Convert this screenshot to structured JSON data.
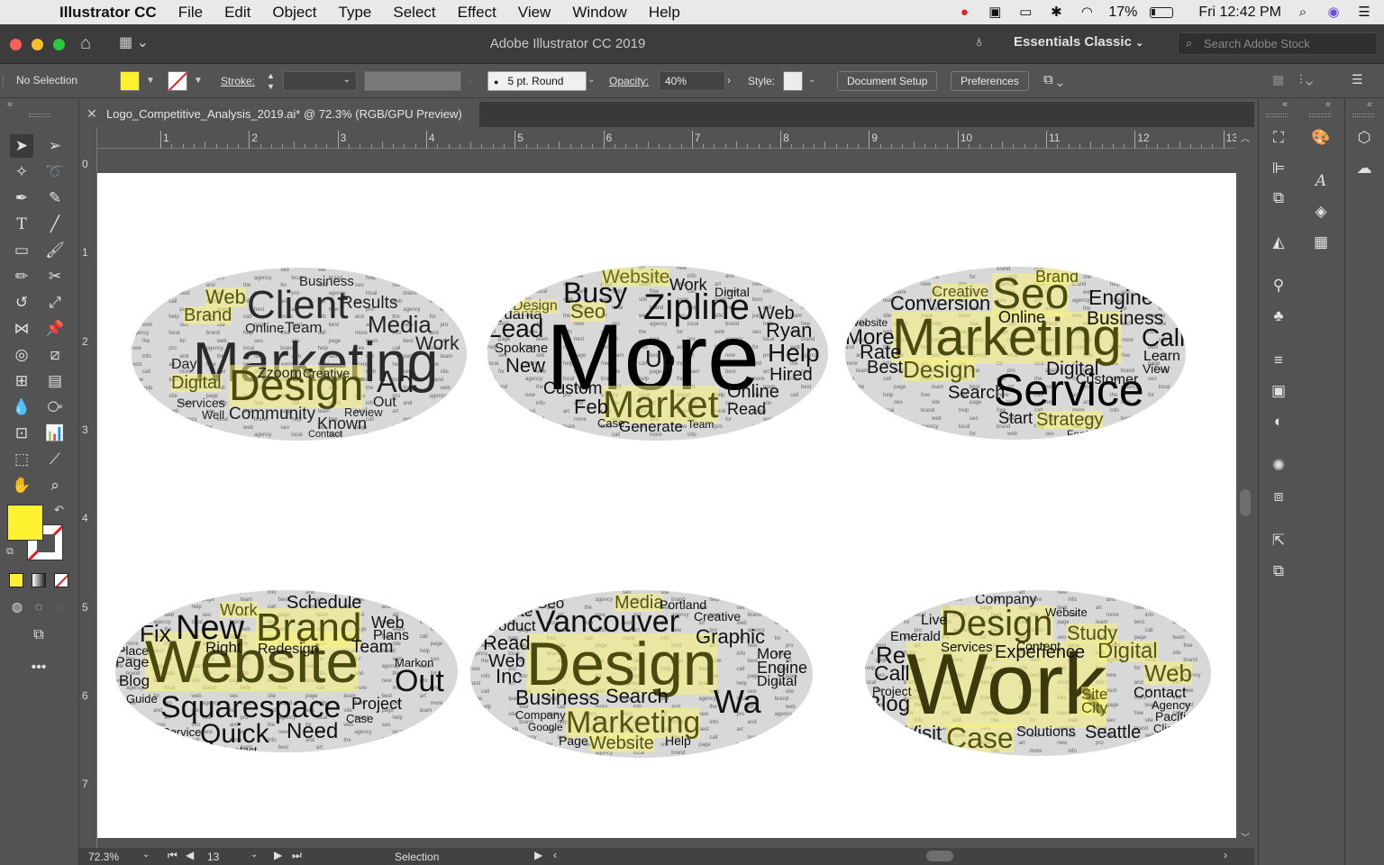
{
  "menubar": {
    "app_name": "Illustrator CC",
    "items": [
      "File",
      "Edit",
      "Object",
      "Type",
      "Select",
      "Effect",
      "View",
      "Window",
      "Help"
    ],
    "battery": "17%",
    "clock": "Fri 12:42 PM"
  },
  "titlebar": {
    "title": "Adobe Illustrator CC 2019",
    "workspace": "Essentials Classic",
    "search_placeholder": "Search Adobe Stock"
  },
  "control": {
    "selection_status": "No Selection",
    "stroke_label": "Stroke:",
    "brush": "5 pt. Round",
    "opacity_label": "Opacity:",
    "opacity_value": "40%",
    "style_label": "Style:",
    "document_setup": "Document Setup",
    "preferences": "Preferences",
    "fill_color": "#fdf22f"
  },
  "document": {
    "tab_title": "Logo_Competitive_Analysis_2019.ai* @ 72.3% (RGB/GPU Preview)"
  },
  "rulers": {
    "top": [
      "1",
      "2",
      "3",
      "4",
      "5",
      "6",
      "7",
      "8",
      "9",
      "10",
      "11",
      "12",
      "13"
    ],
    "left": [
      "0",
      "1",
      "2",
      "3",
      "4",
      "5",
      "6",
      "7"
    ]
  },
  "statusbar": {
    "zoom": "72.3%",
    "artboard_num": "13",
    "tool": "Selection"
  },
  "word_clouds": [
    {
      "words": [
        "Marketing",
        "Client",
        "Design",
        "Media",
        "Brand",
        "Web",
        "Results",
        "Digital",
        "Ad",
        "Community",
        "Known",
        "Team",
        "Work",
        "Online",
        "Out",
        "Review",
        "Business",
        "Zzoom",
        "Creative",
        "Day",
        "Services",
        "Well",
        "Contact"
      ]
    },
    {
      "words": [
        "More",
        "Zipline",
        "Market",
        "Busy",
        "Website",
        "Lead",
        "Help",
        "Quanta",
        "Seo",
        "Hired",
        "Web",
        "Ryan",
        "Feb",
        "Up",
        "Custom",
        "Online",
        "Read",
        "Generate",
        "Spokane",
        "New",
        "Work",
        "Design",
        "Digital",
        "Case",
        "Team"
      ]
    },
    {
      "words": [
        "Marketing",
        "Seo",
        "Service",
        "Conversion",
        "Creative",
        "Brand",
        "Engine",
        "Business",
        "Call",
        "More",
        "Rate",
        "Best",
        "Design",
        "Digital",
        "Search",
        "Strategy",
        "Start",
        "Online",
        "Learn",
        "View",
        "Customer",
        "Features",
        "Website"
      ]
    },
    {
      "words": [
        "Website",
        "Brand",
        "New",
        "Squarespace",
        "Quick",
        "Need",
        "Out",
        "Fix",
        "Schedule",
        "Work",
        "Project",
        "Redesign",
        "Team",
        "Plans",
        "Web",
        "Right",
        "Blog",
        "Page",
        "Place",
        "Guide",
        "Markon",
        "Service",
        "Contact",
        "Case"
      ]
    },
    {
      "words": [
        "Design",
        "Vancouver",
        "Marketing",
        "Business",
        "Search",
        "Wa",
        "Graphic",
        "Website",
        "Media",
        "Product",
        "Read",
        "Web",
        "Inc",
        "Site",
        "Seo",
        "Engine",
        "More",
        "Digital",
        "Creative",
        "Portland",
        "Help",
        "Page",
        "Company",
        "Google"
      ]
    },
    {
      "words": [
        "Work",
        "Design",
        "Case",
        "Experience",
        "Digital",
        "Web",
        "Study",
        "Company",
        "Seattle",
        "Visit",
        "Blog",
        "Call",
        "Re",
        "Contact",
        "Solutions",
        "Services",
        "Emerald",
        "Project",
        "Site",
        "City",
        "Agency",
        "Pacific",
        "Client",
        "Live",
        "Content",
        "Website"
      ]
    }
  ]
}
